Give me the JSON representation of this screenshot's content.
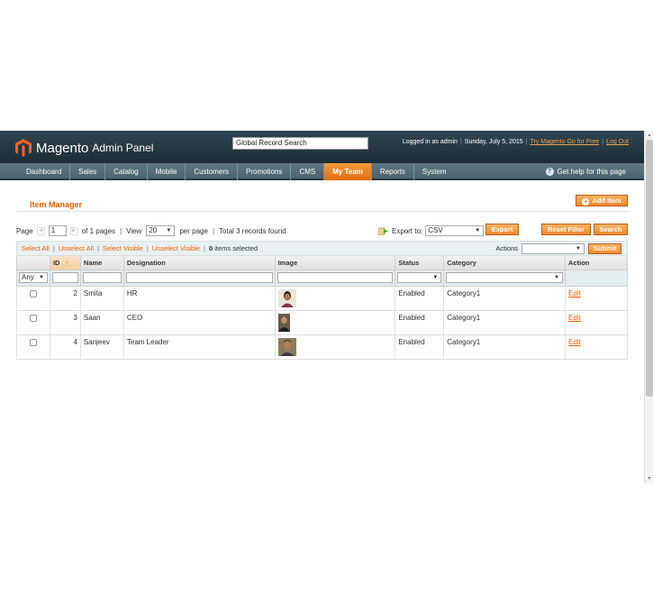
{
  "header": {
    "brand": "Magento",
    "brand_sub": "Admin Panel",
    "search_value": "Global Record Search",
    "logged_in": "Logged in as admin",
    "date": "Sunday, July 5, 2015",
    "try_link": "Try Magento Go for Free",
    "logout": "Log Out"
  },
  "nav": {
    "items": [
      {
        "label": "Dashboard"
      },
      {
        "label": "Sales"
      },
      {
        "label": "Catalog"
      },
      {
        "label": "Mobile"
      },
      {
        "label": "Customers"
      },
      {
        "label": "Promotions"
      },
      {
        "label": "CMS"
      },
      {
        "label": "My Team"
      },
      {
        "label": "Reports"
      },
      {
        "label": "System"
      }
    ],
    "active": "My Team",
    "help": "Get help for this page"
  },
  "page": {
    "title": "Item Manager",
    "add_button": "Add Item"
  },
  "pager": {
    "page_label": "Page",
    "page_value": "1",
    "of_pages": "of 1 pages",
    "view_label": "View",
    "per_page_value": "20",
    "per_page_label": "per page",
    "total": "Total 3 records found",
    "export_label": "Export to:",
    "export_value": "CSV",
    "export_button": "Export",
    "reset_button": "Reset Filter",
    "search_button": "Search"
  },
  "massaction": {
    "select_all": "Select All",
    "unselect_all": "Unselect All",
    "select_visible": "Select Visible",
    "unselect_visible": "Unselect Visible",
    "selected_count": "0",
    "selected_label": "items selected",
    "actions_label": "Actions",
    "submit": "Submit"
  },
  "grid": {
    "columns": [
      "",
      "ID",
      "Name",
      "Designation",
      "Image",
      "Status",
      "Category",
      "Action"
    ],
    "filter_any": "Any",
    "rows": [
      {
        "id": "2",
        "name": "Smita",
        "designation": "HR",
        "status": "Enabled",
        "category": "Category1",
        "action": "Edit"
      },
      {
        "id": "3",
        "name": "Saan",
        "designation": "CEO",
        "status": "Enabled",
        "category": "Category1",
        "action": "Edit"
      },
      {
        "id": "4",
        "name": "Sanjeev",
        "designation": "Team Leader",
        "status": "Enabled",
        "category": "Category1",
        "action": "Edit"
      }
    ]
  },
  "colors": {
    "accent": "#eb5e00",
    "header_bg": "#1c2d35",
    "nav_bg": "#5f7883",
    "button_orange": "#f1882c"
  }
}
